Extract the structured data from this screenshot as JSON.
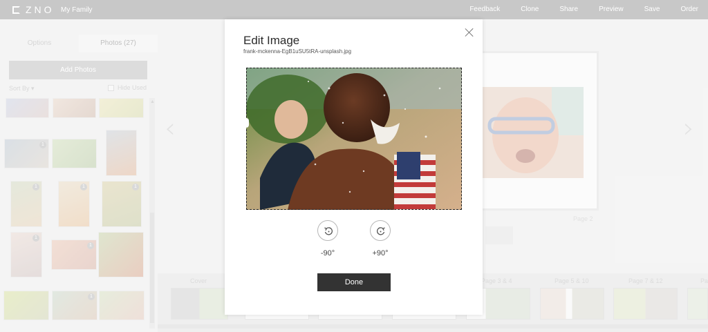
{
  "header": {
    "logo_text": "ZNO",
    "project_name": "My Family",
    "nav": [
      "Feedback",
      "Clone",
      "Share",
      "Preview",
      "Save",
      "Order"
    ]
  },
  "sidebar": {
    "tabs": [
      "Options",
      "Photos (27)"
    ],
    "add_photos_label": "Add Photos",
    "sort_by_label": "Sort By ▾",
    "hide_used_label": "Hide Used",
    "badges": [
      "1",
      "1",
      "1",
      "1",
      "1",
      "1",
      "1"
    ]
  },
  "canvas": {
    "page_label": "Page 2"
  },
  "strip": {
    "labels": [
      "Cover",
      "Page 3 & 4",
      "Page 5 & 10",
      "Page 7 & 12",
      "Pa"
    ]
  },
  "modal": {
    "title": "Edit Image",
    "filename": "frank-mckenna-EgB1uSU5tRA-unsplash.jpg",
    "rotate_ccw_label": "-90°",
    "rotate_cw_label": "+90°",
    "done_label": "Done"
  },
  "colors": {
    "topbar": "#9b9b9b",
    "done_button": "#333333",
    "modal_bg": "#ffffff"
  },
  "icons": {
    "close": "close-icon",
    "rotate_ccw": "rotate-ccw-icon",
    "rotate_cw": "rotate-cw-icon",
    "prev": "chevron-left-icon",
    "next": "chevron-right-icon"
  }
}
